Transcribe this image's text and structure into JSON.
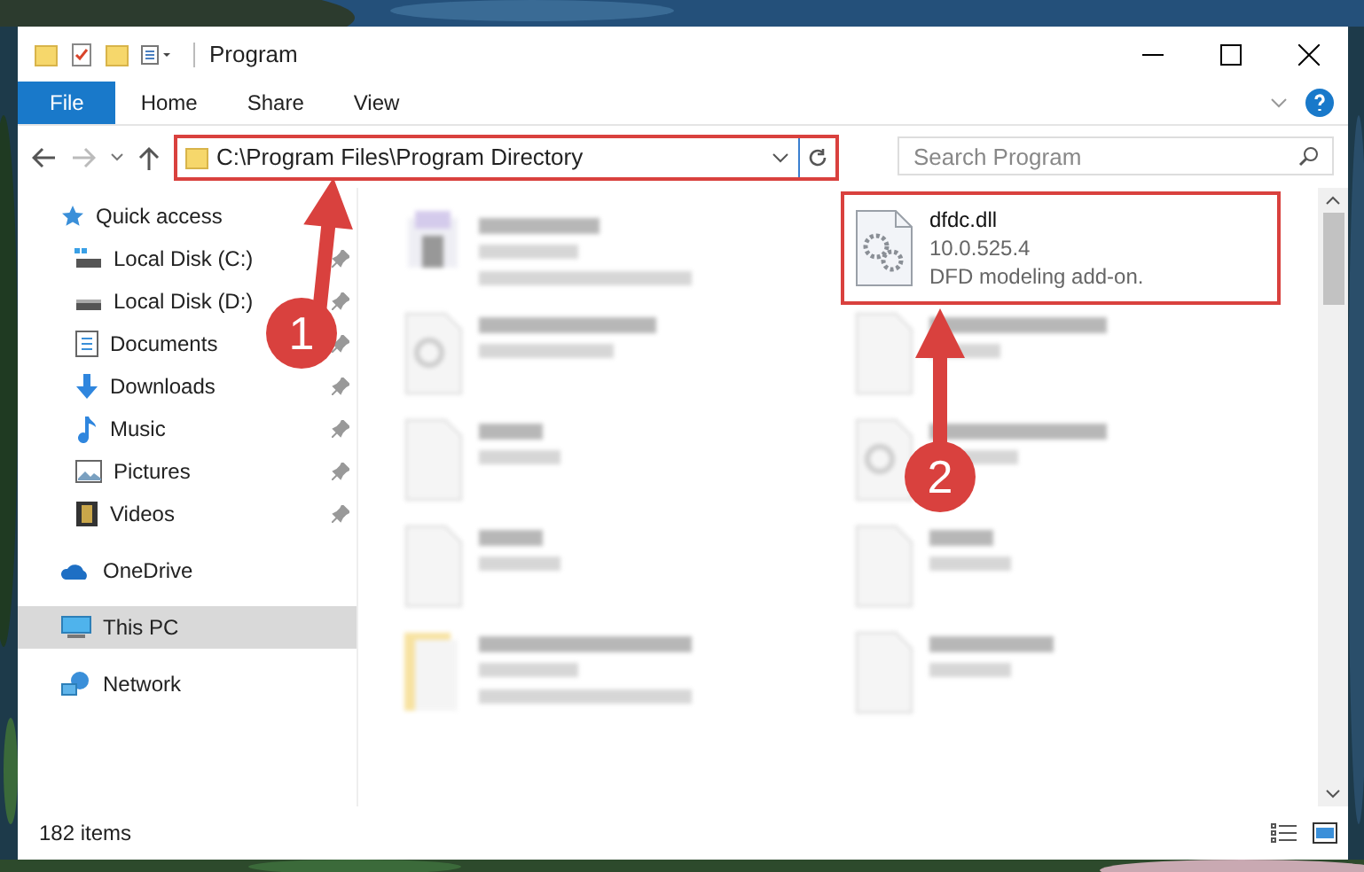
{
  "window": {
    "title": "Program"
  },
  "ribbon": {
    "tabs": [
      {
        "label": "File",
        "kind": "file",
        "selected": false
      },
      {
        "label": "Home",
        "kind": "tab",
        "selected": false
      },
      {
        "label": "Share",
        "kind": "tab",
        "selected": false
      },
      {
        "label": "View",
        "kind": "tab",
        "selected": false
      }
    ]
  },
  "address_bar": {
    "path": "C:\\Program Files\\Program Directory",
    "highlighted": true
  },
  "search": {
    "placeholder": "Search Program"
  },
  "sidebar": {
    "items": [
      {
        "label": "Quick access",
        "kind": "star",
        "group": true,
        "pinned": false,
        "selected": false
      },
      {
        "label": "Local Disk (C:)",
        "kind": "drive-c",
        "group": false,
        "pinned": true,
        "selected": false
      },
      {
        "label": "Local Disk (D:)",
        "kind": "drive",
        "group": false,
        "pinned": true,
        "selected": false
      },
      {
        "label": "Documents",
        "kind": "documents",
        "group": false,
        "pinned": true,
        "selected": false
      },
      {
        "label": "Downloads",
        "kind": "downloads",
        "group": false,
        "pinned": true,
        "selected": false
      },
      {
        "label": "Music",
        "kind": "music",
        "group": false,
        "pinned": true,
        "selected": false
      },
      {
        "label": "Pictures",
        "kind": "pictures",
        "group": false,
        "pinned": true,
        "selected": false
      },
      {
        "label": "Videos",
        "kind": "videos",
        "group": false,
        "pinned": true,
        "selected": false
      },
      {
        "label": "OneDrive",
        "kind": "cloud",
        "group": true,
        "pinned": false,
        "selected": false
      },
      {
        "label": "This PC",
        "kind": "pc",
        "group": true,
        "pinned": false,
        "selected": true
      },
      {
        "label": "Network",
        "kind": "network",
        "group": true,
        "pinned": false,
        "selected": false
      }
    ]
  },
  "files": [
    {
      "name": "dfdc.dll",
      "details": [
        "10.0.525.4",
        "DFD modeling add-on."
      ],
      "kind": "dll",
      "highlighted": true
    }
  ],
  "status_bar": {
    "item_count": "182 items"
  },
  "annotations": [
    {
      "kind": "arrow",
      "label": "1"
    },
    {
      "kind": "arrow",
      "label": "2"
    }
  ]
}
